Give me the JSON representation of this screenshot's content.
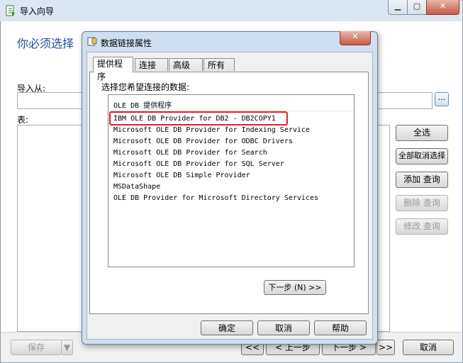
{
  "wizard": {
    "title": "导入向导",
    "heading": "你必须选择",
    "import_from_label": "导入从:",
    "table_label": "表:",
    "browse_label": "...",
    "buttons": {
      "select_all": "全选",
      "deselect_all": "全部取消选择",
      "add_query": "添加 查询",
      "delete_query": "删除 查询",
      "edit_query": "修改 查询"
    },
    "bottom": {
      "save": "保存",
      "first": "<<",
      "prev": "< 上一步",
      "next": "下一步 >",
      "last": ">>",
      "cancel": "取消"
    }
  },
  "dialog": {
    "title": "数据链接属性",
    "tabs": [
      "提供程序",
      "连接",
      "高级",
      "所有"
    ],
    "active_tab": "提供程序",
    "select_label": "选择您希望连接的数据:",
    "list_header": "OLE DB 提供程序",
    "providers": [
      "IBM OLE DB Provider for DB2 - DB2COPY1",
      "Microsoft OLE DB Provider for Indexing Service",
      "Microsoft OLE DB Provider for ODBC Drivers",
      "Microsoft OLE DB Provider for Search",
      "Microsoft OLE DB Provider for SQL Server",
      "Microsoft OLE DB Simple Provider",
      "MSDataShape",
      "OLE DB Provider for Microsoft Directory Services"
    ],
    "selected_provider": "IBM OLE DB Provider for DB2 - DB2COPY1",
    "next_label": "下一步 (N) >>",
    "ok_label": "确定",
    "cancel_label": "取消",
    "help_label": "帮助"
  },
  "colors": {
    "heading": "#1d4e9c",
    "highlight_border": "#e02020",
    "dialog_frame": "#cfdff0"
  }
}
